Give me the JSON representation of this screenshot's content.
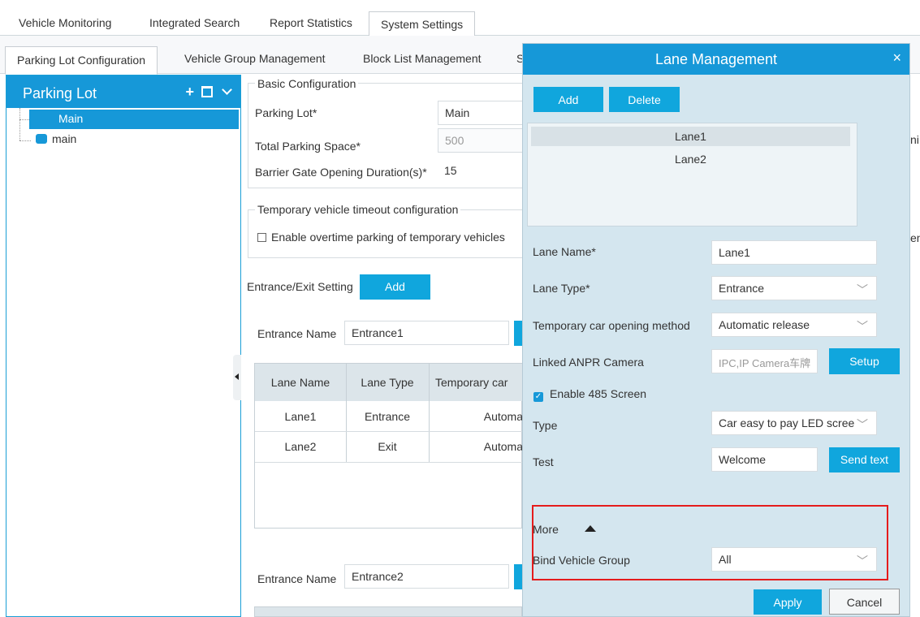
{
  "top_tabs": {
    "t1": "Vehicle Monitoring",
    "t2": "Integrated Search",
    "t3": "Report Statistics",
    "t4": "System Settings"
  },
  "sub_tabs": {
    "t1": "Parking Lot Configuration",
    "t2": "Vehicle Group Management",
    "t3": "Block List Management",
    "t4": "S"
  },
  "left_panel": {
    "title": "Parking Lot",
    "selected": "Main",
    "item": "main"
  },
  "basic": {
    "legend": "Basic Configuration",
    "parking_lot_label": "Parking Lot*",
    "parking_lot_value": "Main",
    "total_label": "Total Parking Space*",
    "total_value": "500",
    "barrier_label": "Barrier Gate Opening Duration(s)*",
    "barrier_value": "15",
    "right_cut_1": "ni"
  },
  "timeout": {
    "legend": "Temporary vehicle timeout configuration",
    "checkbox_label": "Enable overtime parking of temporary vehicles",
    "right_cut_2": "en"
  },
  "entrance_exit": {
    "label": "Entrance/Exit Setting",
    "add": "Add"
  },
  "entrance1": {
    "label": "Entrance Name",
    "value": "Entrance1"
  },
  "entrance2": {
    "label": "Entrance Name",
    "value": "Entrance2"
  },
  "lane_table": {
    "headers": {
      "h1": "Lane Name",
      "h2": "Lane Type",
      "h3": "Temporary car"
    },
    "rows": [
      {
        "name": "Lane1",
        "type": "Entrance",
        "method": "Automa"
      },
      {
        "name": "Lane2",
        "type": "Exit",
        "method": "Automa"
      }
    ]
  },
  "modal": {
    "title": "Lane Management",
    "close": "×",
    "add": "Add",
    "delete": "Delete",
    "lanes": [
      "Lane1",
      "Lane2"
    ],
    "lane_name_label": "Lane Name*",
    "lane_name_value": "Lane1",
    "lane_type_label": "Lane Type*",
    "lane_type_value": "Entrance",
    "temp_label": "Temporary car opening method",
    "temp_value": "Automatic release",
    "camera_label": "Linked ANPR Camera",
    "camera_value": "IPC,IP Camera车牌",
    "setup": "Setup",
    "enable485": "Enable 485 Screen",
    "type_label": "Type",
    "type_value": "Car easy to pay LED scree",
    "test_label": "Test",
    "test_value": "Welcome",
    "send_text": "Send text",
    "more_label": "More",
    "bind_label": "Bind Vehicle Group",
    "bind_value": "All",
    "apply": "Apply",
    "cancel": "Cancel"
  },
  "colors": {
    "accent": "#1698d8",
    "button": "#10a6dd",
    "modal_bg": "#d4e6ef",
    "highlight": "#e51c1c"
  }
}
